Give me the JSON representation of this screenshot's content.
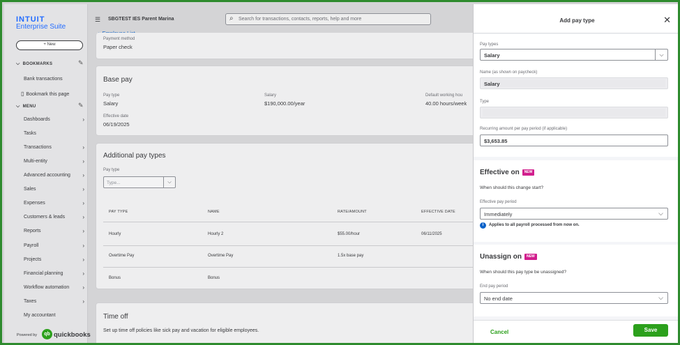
{
  "brand": {
    "logo": "INTUIT",
    "product": "Enterprise Suite",
    "powered_by": "Powered by",
    "qb_mark": "qb",
    "qb_word": "quickbooks"
  },
  "sidebar": {
    "new_label": "+ New",
    "bookmarks_label": "BOOKMARKS",
    "bookmark_items": [
      "Bank transactions",
      "Bookmark this page"
    ],
    "menu_label": "MENU",
    "menu_items": [
      "Dashboards",
      "Tasks",
      "Transactions",
      "Multi-entity",
      "Advanced accounting",
      "Sales",
      "Expenses",
      "Customers & leads",
      "Reports",
      "Payroll",
      "Projects",
      "Financial planning",
      "Workflow automation",
      "Taxes",
      "My accountant"
    ]
  },
  "topbar": {
    "company": "SBGTEST IES Parent Marina",
    "search_placeholder": "Search for transactions, contacts, reports, help and more",
    "back_link": "Employee List"
  },
  "payment": {
    "label": "Payment method",
    "value": "Paper check"
  },
  "base_pay": {
    "title": "Base pay",
    "pay_type_label": "Pay type",
    "pay_type": "Salary",
    "salary_label": "Salary",
    "salary": "$190,000.00/year",
    "hours_label": "Default working hou",
    "hours": "40.00 hours/week",
    "effective_label": "Effective date",
    "effective": "06/19/2025"
  },
  "additional": {
    "title": "Additional pay types",
    "pay_type_label": "Pay type",
    "pay_type_placeholder": "Type...",
    "headers": [
      "PAY TYPE",
      "NAME",
      "RATE/AMOUNT",
      "EFFECTIVE DATE"
    ],
    "rows": [
      [
        "Hourly",
        "Hourly 2",
        "$55.00/hour",
        "06/11/2025"
      ],
      [
        "Overtime Pay",
        "Overtime Pay",
        "1.5x base pay",
        ""
      ],
      [
        "Bonus",
        "Bonus",
        "",
        ""
      ]
    ]
  },
  "time_off": {
    "title": "Time off",
    "desc": "Set up time off policies like sick pay and vacation for eligible employees."
  },
  "panel": {
    "title": "Add pay type",
    "pay_types_label": "Pay types",
    "pay_types_value": "Salary",
    "name_label": "Name (as shown on paycheck)",
    "name_value": "Salary",
    "type_label": "Type",
    "recurring_label": "Recurring amount per pay period (if applicable)",
    "recurring_value": "$3,653.85",
    "effective_title": "Effective on",
    "effective_question": "When should this change start?",
    "effective_period_label": "Effective pay period",
    "effective_period_value": "Immediately",
    "effective_note": "Applies to all payroll processed from now on.",
    "unassign_title": "Unassign on",
    "unassign_question": "When should this pay type be unassigned?",
    "end_period_label": "End pay period",
    "end_period_value": "No end date",
    "new_badge": "NEW",
    "cancel": "Cancel",
    "save": "Save"
  },
  "colors": {
    "accent_green": "#2ca01c",
    "link_blue": "#0d63c9",
    "badge_pink": "#d11e8d",
    "frame_green": "#2e8b2e"
  }
}
